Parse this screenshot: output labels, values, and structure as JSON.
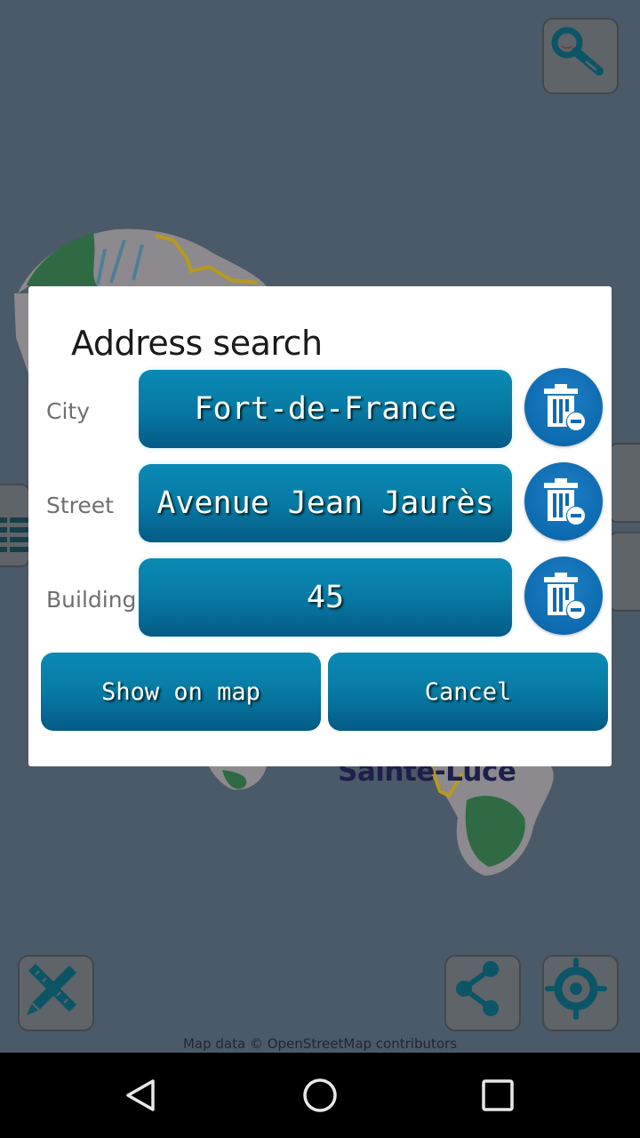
{
  "map": {
    "place_label": "Sainte-Luce",
    "attribution": "Map data © OpenStreetMap contributors",
    "colors": {
      "water": "#4b5a68",
      "land": "#8c8a8e",
      "forest": "#2f6a44",
      "road": "#b59a1c"
    },
    "buttons": {
      "search": "search-icon",
      "measure": "ruler-pencil-icon",
      "share": "share-icon",
      "locate": "crosshair-icon"
    }
  },
  "dialog": {
    "title": "Address search",
    "fields": [
      {
        "label": "City",
        "value": "Fort-de-France"
      },
      {
        "label": "Street",
        "value": "Avenue Jean Jaurès"
      },
      {
        "label": "Building",
        "value": "45"
      }
    ],
    "clear_icon": "trash-minus-icon",
    "show_on_map_label": "Show on map",
    "cancel_label": "Cancel",
    "accent_color": "#077aa4"
  },
  "navbar": {
    "back": "back-triangle-icon",
    "home": "home-circle-icon",
    "recents": "recents-square-icon"
  }
}
